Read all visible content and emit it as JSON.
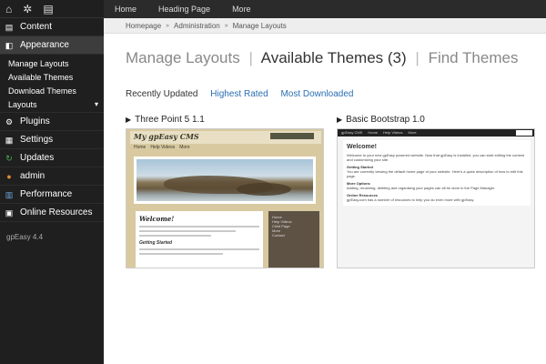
{
  "sidebar": {
    "top_icons": [
      {
        "icon": "home-icon",
        "glyph": "⌂"
      },
      {
        "icon": "gear-icon",
        "glyph": "✲"
      },
      {
        "icon": "document-icon",
        "glyph": "▤"
      }
    ],
    "items": [
      {
        "label": "Content",
        "icon": "document-icon",
        "glyph": "▤"
      },
      {
        "label": "Appearance",
        "icon": "palette-icon",
        "glyph": "◧"
      }
    ],
    "submenu": [
      {
        "label": "Manage Layouts"
      },
      {
        "label": "Available Themes"
      },
      {
        "label": "Download Themes"
      },
      {
        "label": "Layouts",
        "arrow": "▾"
      }
    ],
    "items2": [
      {
        "label": "Plugins",
        "icon": "plugin-icon",
        "glyph": "⚙"
      },
      {
        "label": "Settings",
        "icon": "settings-icon",
        "glyph": "▦"
      },
      {
        "label": "Updates",
        "icon": "refresh-icon",
        "glyph": "↻"
      },
      {
        "label": "admin",
        "icon": "user-icon",
        "glyph": "●"
      },
      {
        "label": "Performance",
        "icon": "chart-icon",
        "glyph": "▥"
      },
      {
        "label": "Online Resources",
        "icon": "resources-icon",
        "glyph": "▣"
      }
    ],
    "version": "gpEasy 4.4"
  },
  "topbar": {
    "links": [
      "Home",
      "Heading Page",
      "More"
    ]
  },
  "breadcrumb": {
    "items": [
      "Homepage",
      "Administration",
      "Manage Layouts"
    ],
    "separator": "»"
  },
  "page": {
    "heading_manage": "Manage Layouts",
    "heading_available": "Available Themes (3)",
    "heading_find": "Find Themes",
    "separator": "|",
    "sort_recent": "Recently Updated",
    "sort_rated": "Highest Rated",
    "sort_downloaded": "Most Downloaded"
  },
  "themes": [
    {
      "name": "Three Point 5 1.1",
      "preview": {
        "logo": "My gpEasy CMS",
        "menu": [
          "Home",
          "Help Videos",
          "More"
        ],
        "welcome": "Welcome!",
        "getting_started": "Getting Started",
        "side": [
          "Home",
          "Help Videos",
          "Child Page",
          "More",
          "Contact"
        ]
      }
    },
    {
      "name": "Basic Bootstrap 1.0",
      "preview": {
        "nav": [
          "gpEasy CMS",
          "Home",
          "Help Videos",
          "More"
        ],
        "welcome": "Welcome!",
        "intro": "Welcome to your new gpEasy powered website. Now that gpEasy is installed, you can start editing the content and customizing your site.",
        "h1": "Getting Started",
        "p1": "You are currently viewing the default home page of your website. Here's a quick description of how to edit this page.",
        "h2": "More Options",
        "p2": "Adding, renaming, deleting and organising your pages can all be done in the Page Manager.",
        "h3": "Online Resources",
        "p3": "gpEasy.com has a number of resources to help you do even more with gpEasy."
      }
    }
  ]
}
